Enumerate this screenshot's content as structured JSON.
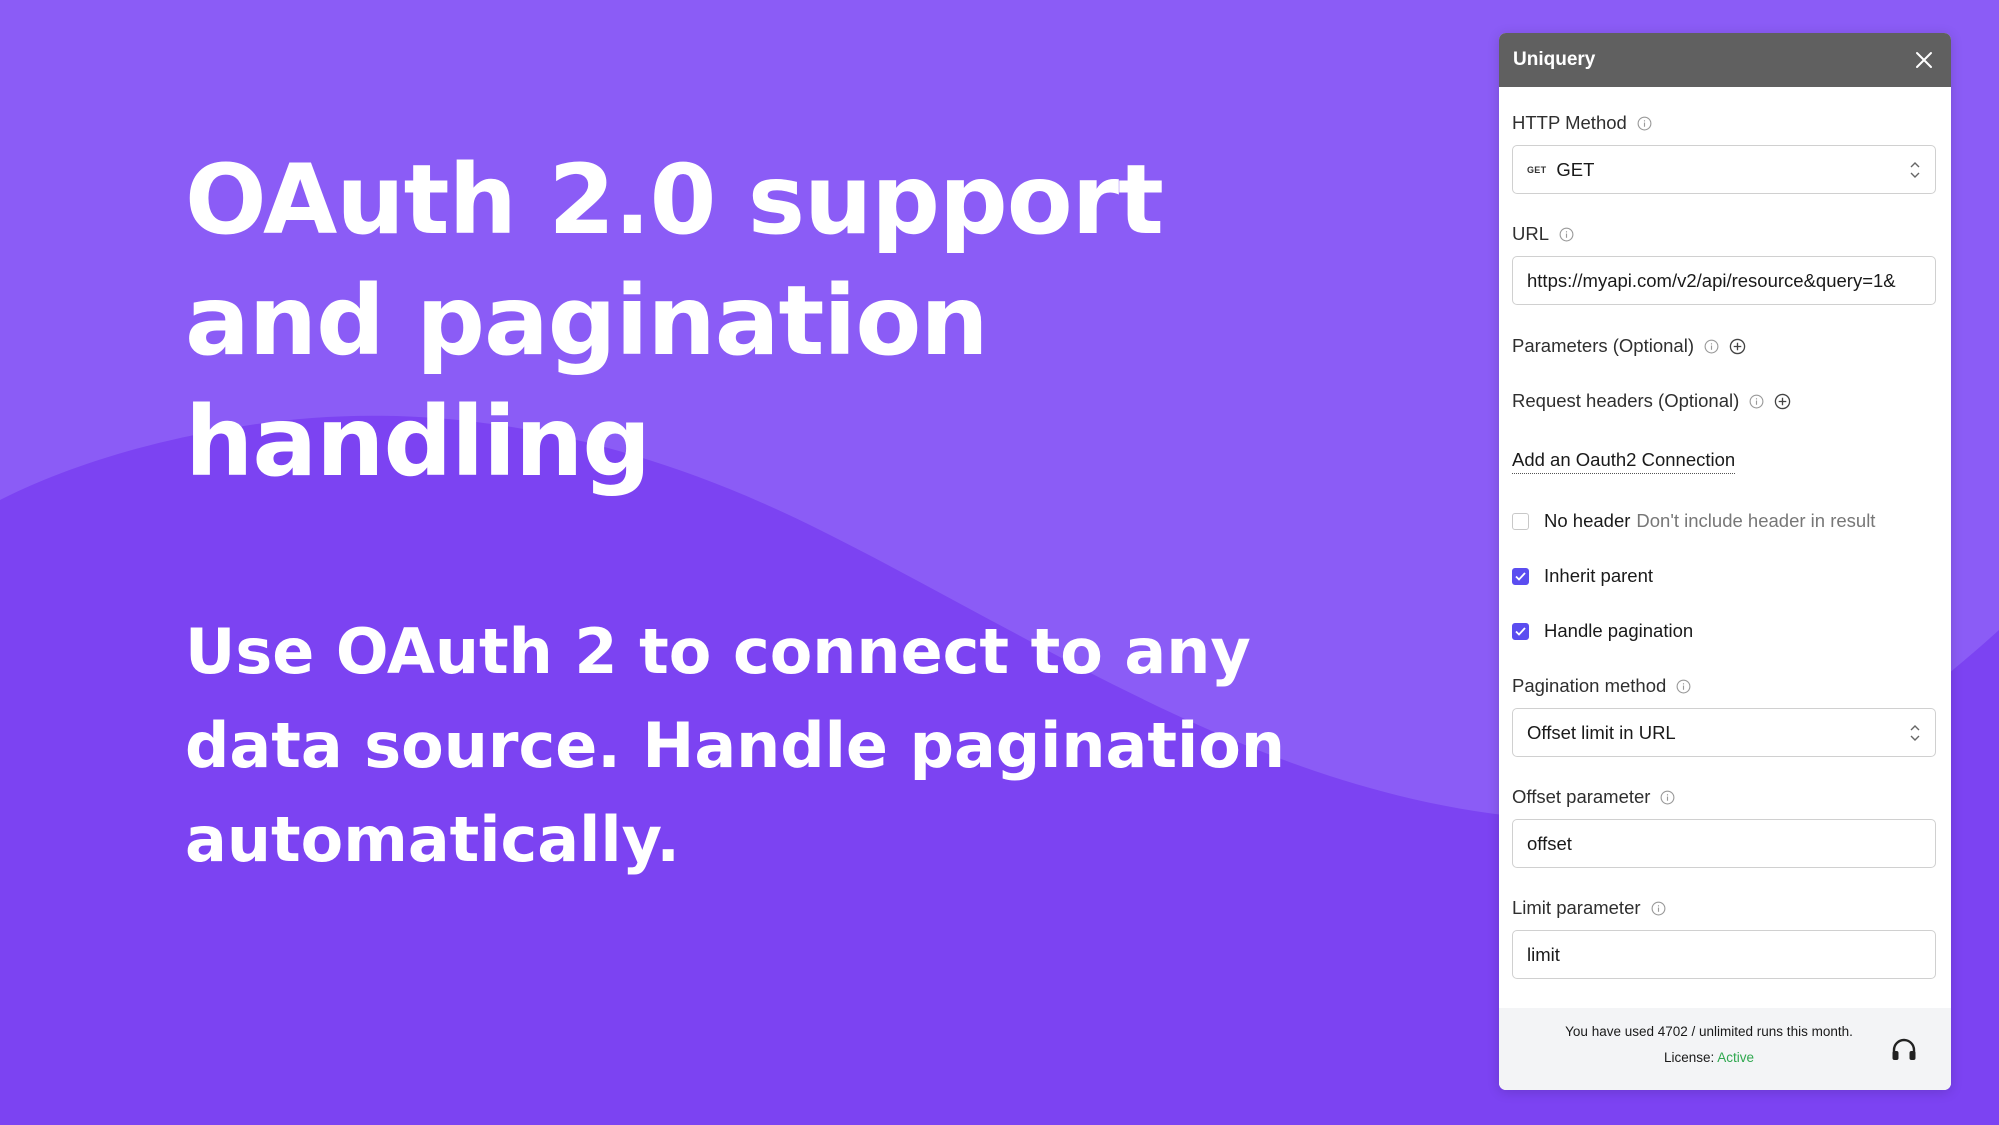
{
  "hero": {
    "title_line1": "OAuth 2.0 support",
    "title_line2": "and pagination",
    "title_line3": "handling",
    "subtitle": "Use OAuth 2 to connect to any data source. Handle pagination automatically."
  },
  "panel": {
    "title": "Uniquery",
    "close_icon": "close-icon",
    "http_method": {
      "label": "HTTP Method",
      "badge": "GET",
      "value": "GET"
    },
    "url": {
      "label": "URL",
      "value": "https://myapi.com/v2/api/resource&query=1&"
    },
    "parameters": {
      "label": "Parameters (Optional)"
    },
    "request_headers": {
      "label": "Request headers (Optional)"
    },
    "oauth_link": "Add an Oauth2 Connection",
    "no_header": {
      "label": "No header",
      "description": "Don't include header in result",
      "checked": false
    },
    "inherit_parent": {
      "label": "Inherit parent",
      "checked": true
    },
    "handle_pagination": {
      "label": "Handle pagination",
      "checked": true
    },
    "pagination_method": {
      "label": "Pagination method",
      "value": "Offset limit in URL"
    },
    "offset_parameter": {
      "label": "Offset parameter",
      "value": "offset"
    },
    "limit_parameter": {
      "label": "Limit parameter",
      "value": "limit"
    },
    "footer": {
      "usage_text": "You have used 4702 / unlimited runs this month.",
      "license_label": "License:",
      "license_status": "Active",
      "support_icon": "headset-icon"
    }
  },
  "colors": {
    "background": "#7c43f2",
    "wave_light": "#8b5cf6",
    "checkbox_accent": "#5b4df0",
    "header_bg": "#606060",
    "license_active": "#2fa84f"
  }
}
